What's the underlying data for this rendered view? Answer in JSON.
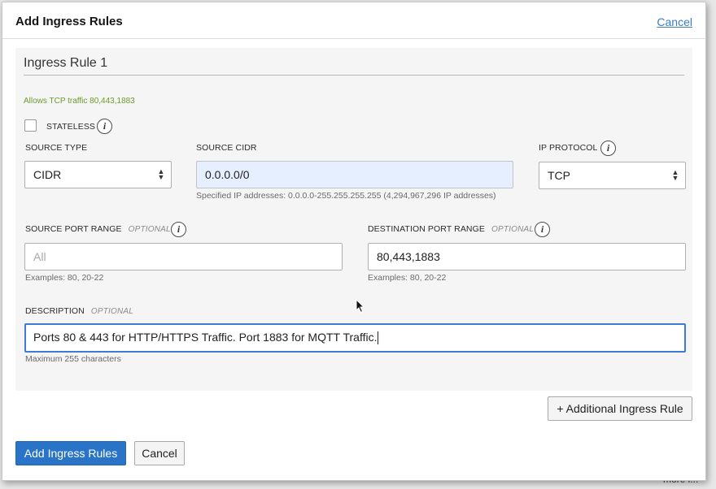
{
  "modal": {
    "title": "Add Ingress Rules",
    "cancel_link": "Cancel"
  },
  "rule": {
    "title": "Ingress Rule 1",
    "summary": "Allows TCP traffic 80,443,1883",
    "stateless": {
      "label": "STATELESS",
      "checked": false,
      "info_icon": "info-icon"
    },
    "source_type": {
      "label": "SOURCE TYPE",
      "value": "CIDR"
    },
    "source_cidr": {
      "label": "SOURCE CIDR",
      "value": "0.0.0.0/0",
      "hint": "Specified IP addresses: 0.0.0.0-255.255.255.255 (4,294,967,296 IP addresses)"
    },
    "ip_protocol": {
      "label": "IP PROTOCOL",
      "value": "TCP"
    },
    "source_port_range": {
      "label": "SOURCE PORT RANGE",
      "optional": "OPTIONAL",
      "placeholder": "All",
      "value": "",
      "hint": "Examples: 80, 20-22"
    },
    "destination_port_range": {
      "label": "DESTINATION PORT RANGE",
      "optional": "OPTIONAL",
      "value": "80,443,1883",
      "hint": "Examples: 80, 20-22"
    },
    "description": {
      "label": "DESCRIPTION",
      "optional": "OPTIONAL",
      "value": "Ports 80 & 443 for HTTP/HTTPS Traffic. Port 1883 for MQTT Traffic.",
      "hint": "Maximum 255 characters"
    }
  },
  "buttons": {
    "additional_rule": "+ Additional Ingress Rule",
    "add_rules": "Add Ingress Rules",
    "cancel": "Cancel"
  },
  "background": {
    "partial_text": "more i..."
  },
  "colors": {
    "accent_blue": "#2a74c8",
    "link_blue": "#3a7dbd",
    "summary_green": "#6c9a2c",
    "cidr_fill": "#e6efff"
  }
}
